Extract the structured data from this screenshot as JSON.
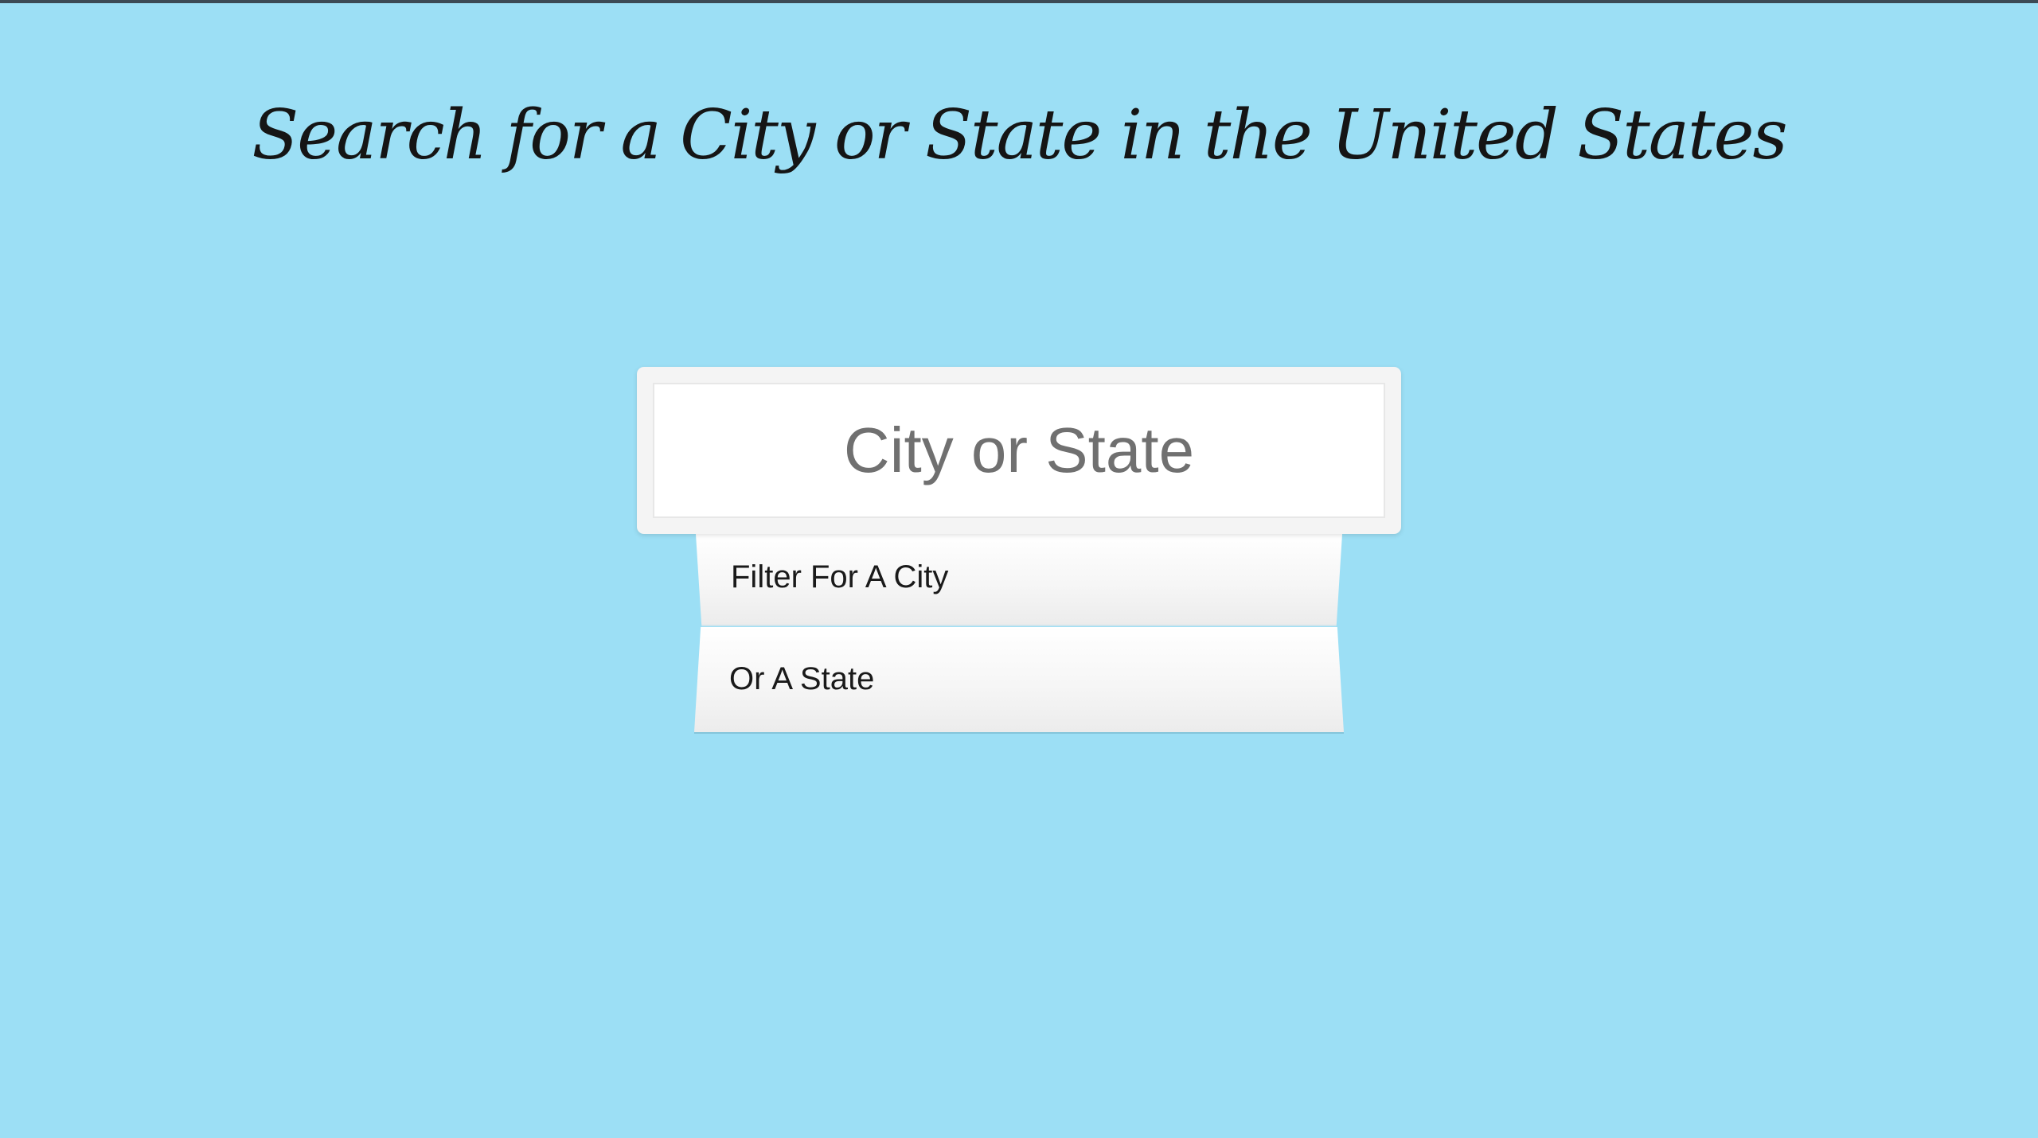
{
  "header": {
    "title": "Search for a City or State in the United States"
  },
  "search": {
    "placeholder": "City or State",
    "value": ""
  },
  "suggestions": [
    {
      "label": "Filter For A City"
    },
    {
      "label": "Or A State"
    }
  ],
  "colors": {
    "background": "#9cdff5",
    "top_border": "#3c4a55",
    "card": "#f4f4f4",
    "input_text": "#707070",
    "title_text": "#151515"
  }
}
